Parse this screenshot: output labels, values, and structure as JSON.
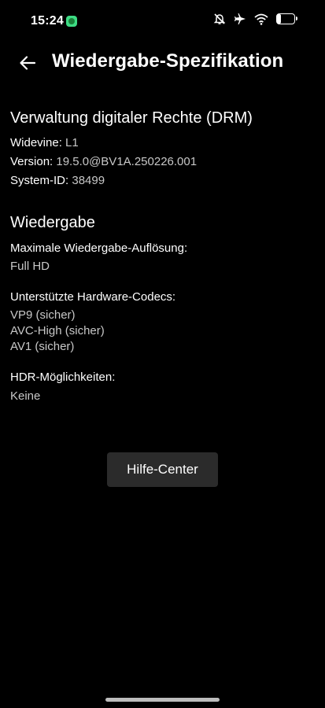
{
  "status_bar": {
    "time": "15:24",
    "app_icon": "green-app-badge",
    "icons": [
      "mute-icon",
      "airplane-icon",
      "wifi-icon"
    ],
    "battery_level": "24",
    "battery_fraction": 0.24
  },
  "header": {
    "back_icon": "arrow-left-icon",
    "title": "Wiedergabe-Spezifikation"
  },
  "drm": {
    "title": "Verwaltung digitaler Rechte (DRM)",
    "widevine_label": "Widevine:",
    "widevine_value": "L1",
    "version_label": "Version:",
    "version_value": "19.5.0@BV1A.250226.001",
    "system_id_label": "System-ID:",
    "system_id_value": "38499"
  },
  "playback": {
    "title": "Wiedergabe",
    "max_resolution_label": "Maximale Wiedergabe-Auflösung:",
    "max_resolution_value": "Full HD",
    "codecs_label": "Unterstützte Hardware-Codecs:",
    "codecs": [
      "VP9 (sicher)",
      "AVC-High (sicher)",
      "AV1 (sicher)"
    ],
    "hdr_label": "HDR-Möglichkeiten:",
    "hdr_value": "Keine"
  },
  "help_button_label": "Hilfe-Center",
  "colors": {
    "background": "#000000",
    "text": "#ffffff",
    "secondary_text": "#c8c8c8",
    "button_bg": "#2b2b2b"
  }
}
